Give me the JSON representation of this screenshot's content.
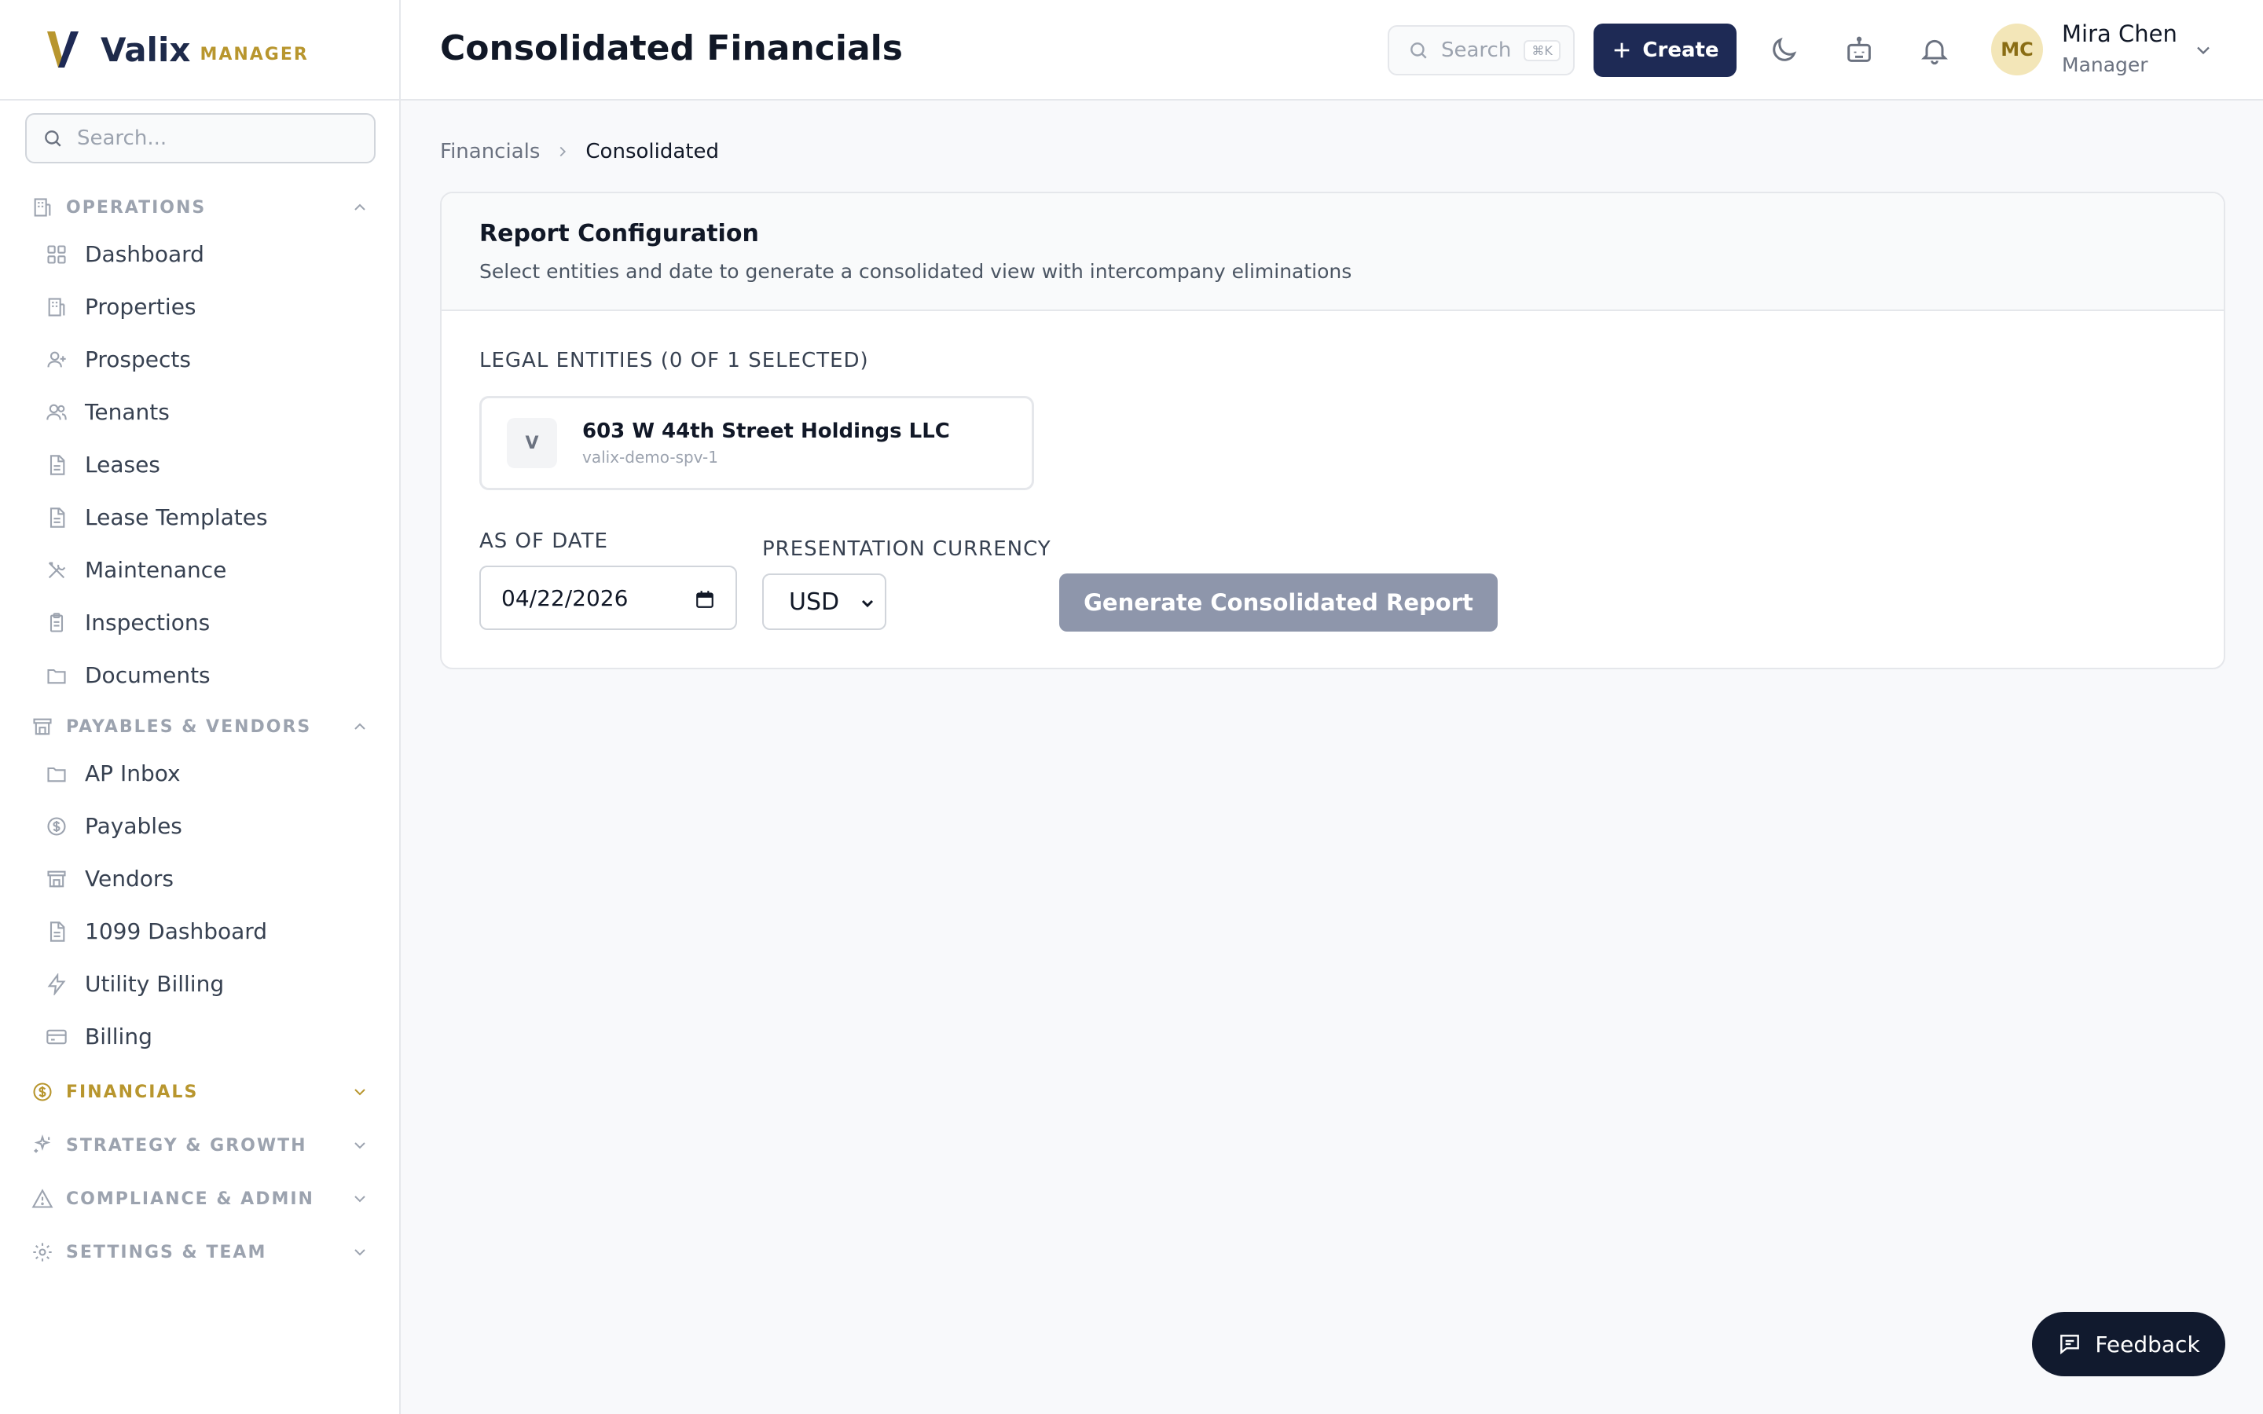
{
  "app": {
    "name": "Valix",
    "subtitle": "MANAGER",
    "brand_color": "#1e2a55",
    "accent_color": "#b8962e"
  },
  "sidebar": {
    "search_placeholder": "Search...",
    "sections": [
      {
        "title": "OPERATIONS",
        "icon": "building-icon",
        "expanded": true,
        "items": [
          {
            "label": "Dashboard",
            "icon": "grid-icon"
          },
          {
            "label": "Properties",
            "icon": "building-icon"
          },
          {
            "label": "Prospects",
            "icon": "user-plus-icon"
          },
          {
            "label": "Tenants",
            "icon": "users-icon"
          },
          {
            "label": "Leases",
            "icon": "file-icon"
          },
          {
            "label": "Lease Templates",
            "icon": "file-icon"
          },
          {
            "label": "Maintenance",
            "icon": "wrench-icon"
          },
          {
            "label": "Inspections",
            "icon": "clipboard-icon"
          },
          {
            "label": "Documents",
            "icon": "folder-icon"
          }
        ]
      },
      {
        "title": "PAYABLES & VENDORS",
        "icon": "store-icon",
        "expanded": true,
        "items": [
          {
            "label": "AP Inbox",
            "icon": "folder-icon"
          },
          {
            "label": "Payables",
            "icon": "dollar-icon"
          },
          {
            "label": "Vendors",
            "icon": "store-icon"
          },
          {
            "label": "1099 Dashboard",
            "icon": "file-icon"
          },
          {
            "label": "Utility Billing",
            "icon": "bolt-icon"
          },
          {
            "label": "Billing",
            "icon": "card-icon"
          }
        ]
      },
      {
        "title": "FINANCIALS",
        "icon": "dollar-icon",
        "expanded": false,
        "active": true
      },
      {
        "title": "STRATEGY & GROWTH",
        "icon": "sparkle-icon",
        "expanded": false
      },
      {
        "title": "COMPLIANCE & ADMIN",
        "icon": "alert-icon",
        "expanded": false
      },
      {
        "title": "SETTINGS & TEAM",
        "icon": "gear-icon",
        "expanded": false
      }
    ]
  },
  "header": {
    "title": "Consolidated Financials",
    "search_placeholder": "Search",
    "search_shortcut": "⌘K",
    "create_label": "Create",
    "user": {
      "initials": "MC",
      "name": "Mira Chen",
      "role": "Manager"
    }
  },
  "breadcrumb": {
    "parent": "Financials",
    "current": "Consolidated"
  },
  "report": {
    "title": "Report Configuration",
    "subtitle": "Select entities and date to generate a consolidated view with intercompany eliminations",
    "entities_label": "LEGAL ENTITIES (0 OF 1 SELECTED)",
    "entities": [
      {
        "initial": "V",
        "name": "603 W 44th Street Holdings LLC",
        "code": "valix-demo-spv-1"
      }
    ],
    "date_label": "AS OF DATE",
    "date_value": "04/22/2026",
    "currency_label": "PRESENTATION CURRENCY",
    "currency_value": "USD",
    "generate_label": "Generate Consolidated Report"
  },
  "feedback_label": "Feedback"
}
